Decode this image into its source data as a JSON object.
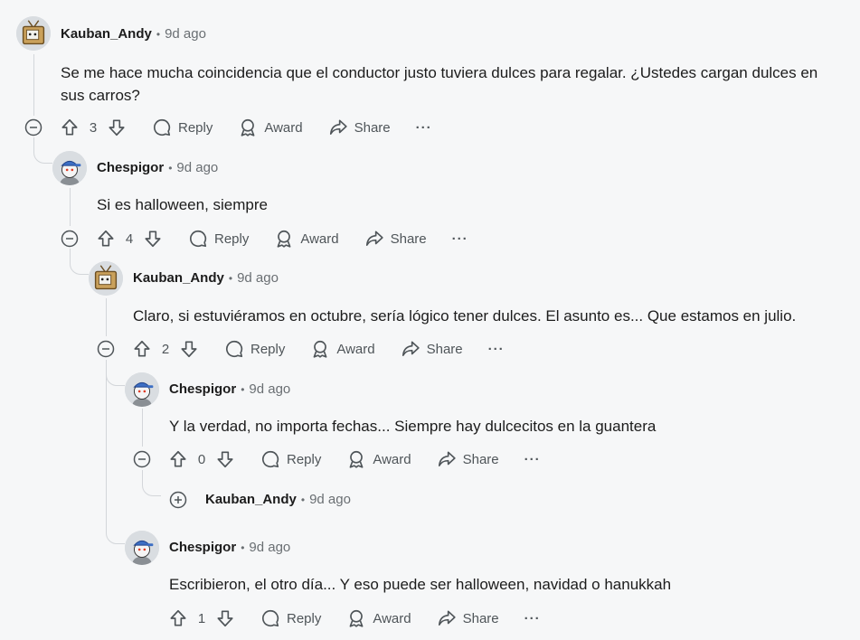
{
  "labels": {
    "reply": "Reply",
    "award": "Award",
    "share": "Share",
    "more": "···"
  },
  "comments": [
    {
      "user": "Kauban_Andy",
      "time": "9d ago",
      "text": "Se me hace mucha coincidencia que el conductor justo tuviera dulces para regalar. ¿Ustedes cargan dulces en sus carros?",
      "votes": "3",
      "avatar": "tv-robot"
    },
    {
      "user": "Chespigor",
      "time": "9d ago",
      "text": "Si es halloween, siempre",
      "votes": "4",
      "avatar": "snoo-blue-cap"
    },
    {
      "user": "Kauban_Andy",
      "time": "9d ago",
      "text": "Claro, si estuviéramos en octubre, sería lógico tener dulces. El asunto es... Que estamos en julio.",
      "votes": "2",
      "avatar": "tv-robot"
    },
    {
      "user": "Chespigor",
      "time": "9d ago",
      "text": "Y la verdad, no importa fechas... Siempre hay dulcecitos en la guantera",
      "votes": "0",
      "avatar": "snoo-blue-cap"
    },
    {
      "user": "Kauban_Andy",
      "time": "9d ago",
      "collapsed": true
    },
    {
      "user": "Chespigor",
      "time": "9d ago",
      "text": "Escribieron, el otro día... Y eso puede ser halloween, navidad o hanukkah",
      "votes": "1",
      "avatar": "snoo-blue-cap"
    }
  ]
}
